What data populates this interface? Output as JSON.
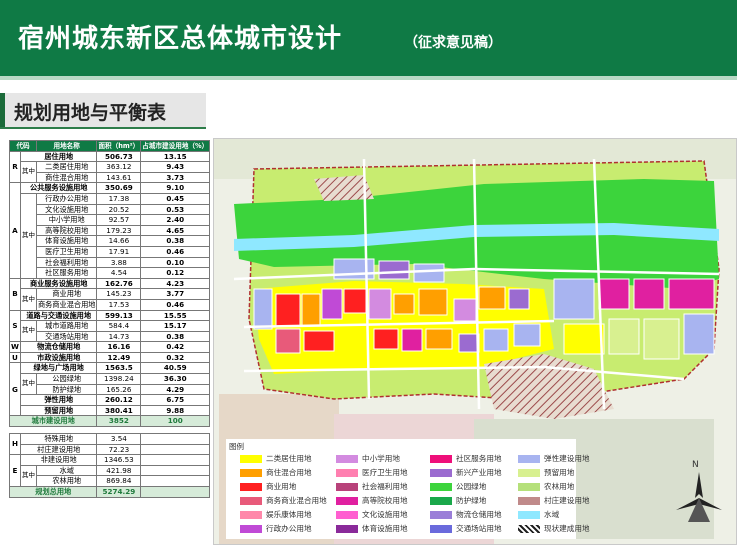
{
  "header": {
    "title": "宿州城东新区总体城市设计",
    "subtitle": "（征求意见稿）"
  },
  "section": {
    "title": "规划用地与平衡表"
  },
  "table": {
    "headers": {
      "code": "代码",
      "name": "用地名称",
      "area": "面积（hm²）",
      "ratio": "占城市建设用地（%）"
    },
    "rows": [
      {
        "code": "R",
        "sub": "",
        "name": "居住用地",
        "area": "506.73",
        "ratio": "13.15"
      },
      {
        "code": "",
        "sub": "其中",
        "name": "二类居住用地",
        "area": "363.12",
        "ratio": "9.43"
      },
      {
        "code": "",
        "sub": "",
        "name": "商住混合用地",
        "area": "143.61",
        "ratio": "3.73"
      },
      {
        "code": "A",
        "sub": "",
        "name": "公共服务设施用地",
        "area": "350.69",
        "ratio": "9.10"
      },
      {
        "code": "",
        "sub": "其中",
        "name": "行政办公用地",
        "area": "17.38",
        "ratio": "0.45"
      },
      {
        "code": "",
        "sub": "",
        "name": "文化设施用地",
        "area": "20.52",
        "ratio": "0.53"
      },
      {
        "code": "",
        "sub": "",
        "name": "中小学用地",
        "area": "92.57",
        "ratio": "2.40"
      },
      {
        "code": "",
        "sub": "",
        "name": "高等院校用地",
        "area": "179.23",
        "ratio": "4.65"
      },
      {
        "code": "",
        "sub": "",
        "name": "体育设施用地",
        "area": "14.66",
        "ratio": "0.38"
      },
      {
        "code": "",
        "sub": "",
        "name": "医疗卫生用地",
        "area": "17.91",
        "ratio": "0.46"
      },
      {
        "code": "",
        "sub": "",
        "name": "社会福利用地",
        "area": "3.88",
        "ratio": "0.10"
      },
      {
        "code": "",
        "sub": "",
        "name": "社区服务用地",
        "area": "4.54",
        "ratio": "0.12"
      },
      {
        "code": "B",
        "sub": "",
        "name": "商业服务设施用地",
        "area": "162.76",
        "ratio": "4.23"
      },
      {
        "code": "",
        "sub": "其中",
        "name": "商业用地",
        "area": "145.23",
        "ratio": "3.77"
      },
      {
        "code": "",
        "sub": "",
        "name": "商务商业混合用地",
        "area": "17.53",
        "ratio": "0.46"
      },
      {
        "code": "S",
        "sub": "",
        "name": "道路与交通设施用地",
        "area": "599.13",
        "ratio": "15.55"
      },
      {
        "code": "",
        "sub": "其中",
        "name": "城市道路用地",
        "area": "584.4",
        "ratio": "15.17"
      },
      {
        "code": "",
        "sub": "",
        "name": "交通场站用地",
        "area": "14.73",
        "ratio": "0.38"
      },
      {
        "code": "W",
        "sub": "",
        "name": "物流仓储用地",
        "area": "16.16",
        "ratio": "0.42"
      },
      {
        "code": "U",
        "sub": "",
        "name": "市政设施用地",
        "area": "12.49",
        "ratio": "0.32"
      },
      {
        "code": "G",
        "sub": "",
        "name": "绿地与广场用地",
        "area": "1563.5",
        "ratio": "40.59"
      },
      {
        "code": "",
        "sub": "其中",
        "name": "公园绿地",
        "area": "1398.24",
        "ratio": "36.30"
      },
      {
        "code": "",
        "sub": "",
        "name": "防护绿地",
        "area": "165.26",
        "ratio": "4.29"
      },
      {
        "code": "",
        "sub": "",
        "name": "弹性用地",
        "area": "260.12",
        "ratio": "6.75"
      },
      {
        "code": "",
        "sub": "",
        "name": "预留用地",
        "area": "380.41",
        "ratio": "9.88"
      }
    ],
    "total_build": {
      "name": "城市建设用地",
      "area": "3852",
      "ratio": "100"
    },
    "rows2": [
      {
        "code": "H",
        "sub": "",
        "name": "特殊用地",
        "area": "3.54"
      },
      {
        "code": "",
        "sub": "",
        "name": "村庄建设用地",
        "area": "72.23"
      },
      {
        "code": "E",
        "sub": "",
        "name": "非建设用地",
        "area": "1346.53"
      },
      {
        "code": "",
        "sub": "其中",
        "name": "水域",
        "area": "421.98"
      },
      {
        "code": "",
        "sub": "",
        "name": "农林用地",
        "area": "869.84"
      }
    ],
    "total_all": {
      "name": "规划总用地",
      "area": "5274.29"
    }
  },
  "legend": {
    "title": "图例",
    "items": [
      {
        "label": "二类居住用地",
        "color": "#ffff00"
      },
      {
        "label": "商住混合用地",
        "color": "#ff9f00"
      },
      {
        "label": "商业用地",
        "color": "#ff2020"
      },
      {
        "label": "商务商业混合用地",
        "color": "#e85a7a"
      },
      {
        "label": "娱乐康体用地",
        "color": "#ff88aa"
      },
      {
        "label": "行政办公用地",
        "color": "#c04ad6"
      },
      {
        "label": "中小学用地",
        "color": "#d38be0"
      },
      {
        "label": "医疗卫生用地",
        "color": "#ff7fb0"
      },
      {
        "label": "社会福利用地",
        "color": "#b8427a"
      },
      {
        "label": "高等院校用地",
        "color": "#e020a0"
      },
      {
        "label": "文化设施用地",
        "color": "#ff5fd0"
      },
      {
        "label": "体育设施用地",
        "color": "#8a2a9a"
      },
      {
        "label": "社区服务用地",
        "color": "#ee0f7a"
      },
      {
        "label": "新兴产业用地",
        "color": "#9b6bd0"
      },
      {
        "label": "公园绿地",
        "color": "#3cd43c"
      },
      {
        "label": "防护绿地",
        "color": "#1aa84a"
      },
      {
        "label": "物流仓储用地",
        "color": "#9a7ed8"
      },
      {
        "label": "交通场站用地",
        "color": "#6a6adc"
      },
      {
        "label": "弹性建设用地",
        "color": "#a8b4f0"
      },
      {
        "label": "预留用地",
        "color": "#d8f090"
      },
      {
        "label": "农林用地",
        "color": "#b5e07a"
      },
      {
        "label": "村庄建设用地",
        "color": "#c08a8a"
      },
      {
        "label": "水域",
        "color": "#8fe8ff"
      },
      {
        "label": "现状建成用地",
        "color": "hatch"
      }
    ]
  },
  "compass": {
    "letter": "N"
  }
}
